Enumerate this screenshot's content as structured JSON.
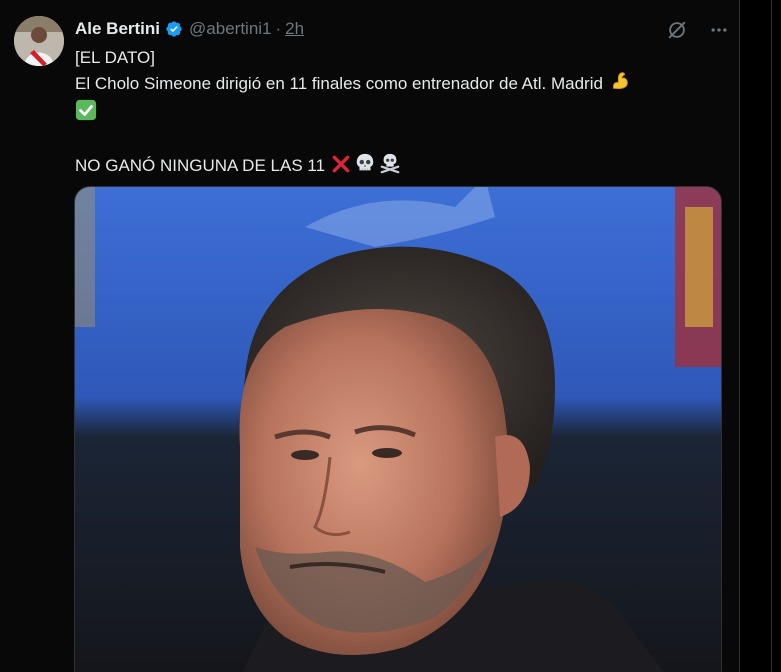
{
  "tweet": {
    "author_name": "Ale Bertini",
    "handle": "@abertini1",
    "separator": "·",
    "timestamp": "2h",
    "lines": [
      "[EL DATO]",
      "El Cholo Simeone dirigió en 11 finales como entrenador de Atl. Madrid",
      "",
      "NO GANÓ NINGUNA DE LAS 11"
    ]
  },
  "icons": {
    "verified": "verified-badge-icon",
    "grok": "grok-icon",
    "more": "more-icon",
    "emojis_line2": [
      "flexed-biceps-emoji",
      "check-mark-emoji"
    ],
    "emojis_line4": [
      "cross-mark-emoji",
      "skull-emoji",
      "skull-crossbones-emoji"
    ]
  },
  "colors": {
    "background": "#080808",
    "text": "#e7e9ea",
    "muted": "#71767b",
    "verified": "#1d9bf0"
  }
}
